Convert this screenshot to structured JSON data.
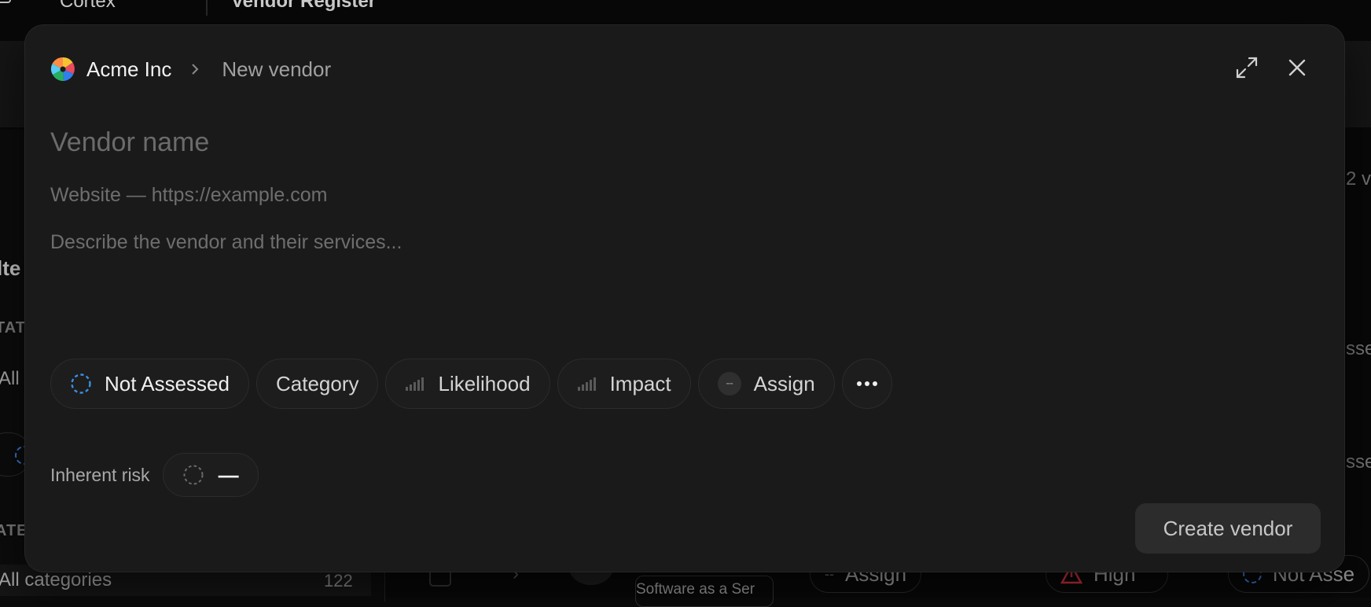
{
  "background": {
    "app_name": "Cortex",
    "page_title": "Vendor Register",
    "sidebar_filter_title": "lte",
    "status_heading": "TAT",
    "status_filter_value": "All",
    "category_heading": "ATE",
    "category_filter_value": "All categories",
    "category_count": "122",
    "row_category": "Software as a Ser",
    "row_assign": "Assign",
    "row_risk": "High",
    "row_status": "Not Asse",
    "right_edge_1": "2 v",
    "right_edge_2": "sse",
    "right_edge_3": "sse"
  },
  "modal": {
    "org_name": "Acme Inc",
    "breadcrumb_current": "New vendor",
    "vendor_name_placeholder": "Vendor name",
    "website_placeholder": "Website — https://example.com",
    "description_placeholder": "Describe the vendor and their services...",
    "chips": {
      "status": "Not Assessed",
      "category": "Category",
      "likelihood": "Likelihood",
      "impact": "Impact",
      "assign_avatar": "--",
      "assign": "Assign"
    },
    "inherent_risk_label": "Inherent risk",
    "inherent_risk_value": "—",
    "create_button": "Create vendor"
  },
  "colors": {
    "status_ring": "#3b8fe0",
    "modal_bg": "#1a1a1a"
  }
}
